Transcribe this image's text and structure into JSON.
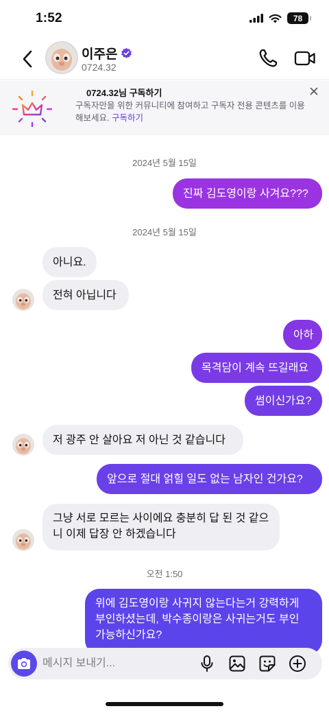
{
  "status_bar": {
    "time": "1:52",
    "battery": "78"
  },
  "header": {
    "name": "이주은",
    "subtitle": "0724.32",
    "icons": [
      "back-icon",
      "verified-badge-icon",
      "phone-icon",
      "video-camera-icon"
    ]
  },
  "promo": {
    "title": "0724.32님 구독하기",
    "body": "구독자만을 위한 커뮤니티에 참여하고 구독자 전용 콘텐츠를 이용해보세요.",
    "link": "구독하기",
    "icons": [
      "crown-icon",
      "close-icon"
    ]
  },
  "messages": [
    {
      "type": "date",
      "text": "2024년 5월 15일"
    },
    {
      "type": "out",
      "text": "진짜 김도영이랑 사겨요???"
    },
    {
      "type": "date",
      "text": "2024년 5월 15일"
    },
    {
      "type": "in",
      "text": "아니요."
    },
    {
      "type": "in",
      "text": "전혀 아닙니다"
    },
    {
      "type": "out",
      "text": "아하"
    },
    {
      "type": "out",
      "text": "목격담이 계속 뜨길래요"
    },
    {
      "type": "out",
      "text": "썸이신가요?"
    },
    {
      "type": "in",
      "text": "저 광주 안 살아요 저 아닌 것 같습니다"
    },
    {
      "type": "out",
      "text": "앞으로 절대 얽힐 일도 없는 남자인 건가요?"
    },
    {
      "type": "in",
      "text": "그냥 서로 모르는 사이에요 충분히 답 된 것 같으니 이제 답장 안 하겠습니다"
    },
    {
      "type": "date",
      "text": "오전 1:50"
    },
    {
      "type": "out",
      "text": "위에 김도영이랑 사귀지 않는다는거 강력하게 부인하셨는데, 박수종이랑은 사귀는거도 부인 가능하신가요?"
    }
  ],
  "composer": {
    "placeholder": "메시지 보내기...",
    "icons": [
      "camera-icon",
      "microphone-icon",
      "gallery-icon",
      "sticker-icon",
      "add-icon"
    ]
  },
  "colors": {
    "outgoing_top": "#9b33e0",
    "outgoing_bottom": "#5b44ea",
    "incoming": "#efeff3",
    "accent": "#6a3ee6"
  }
}
